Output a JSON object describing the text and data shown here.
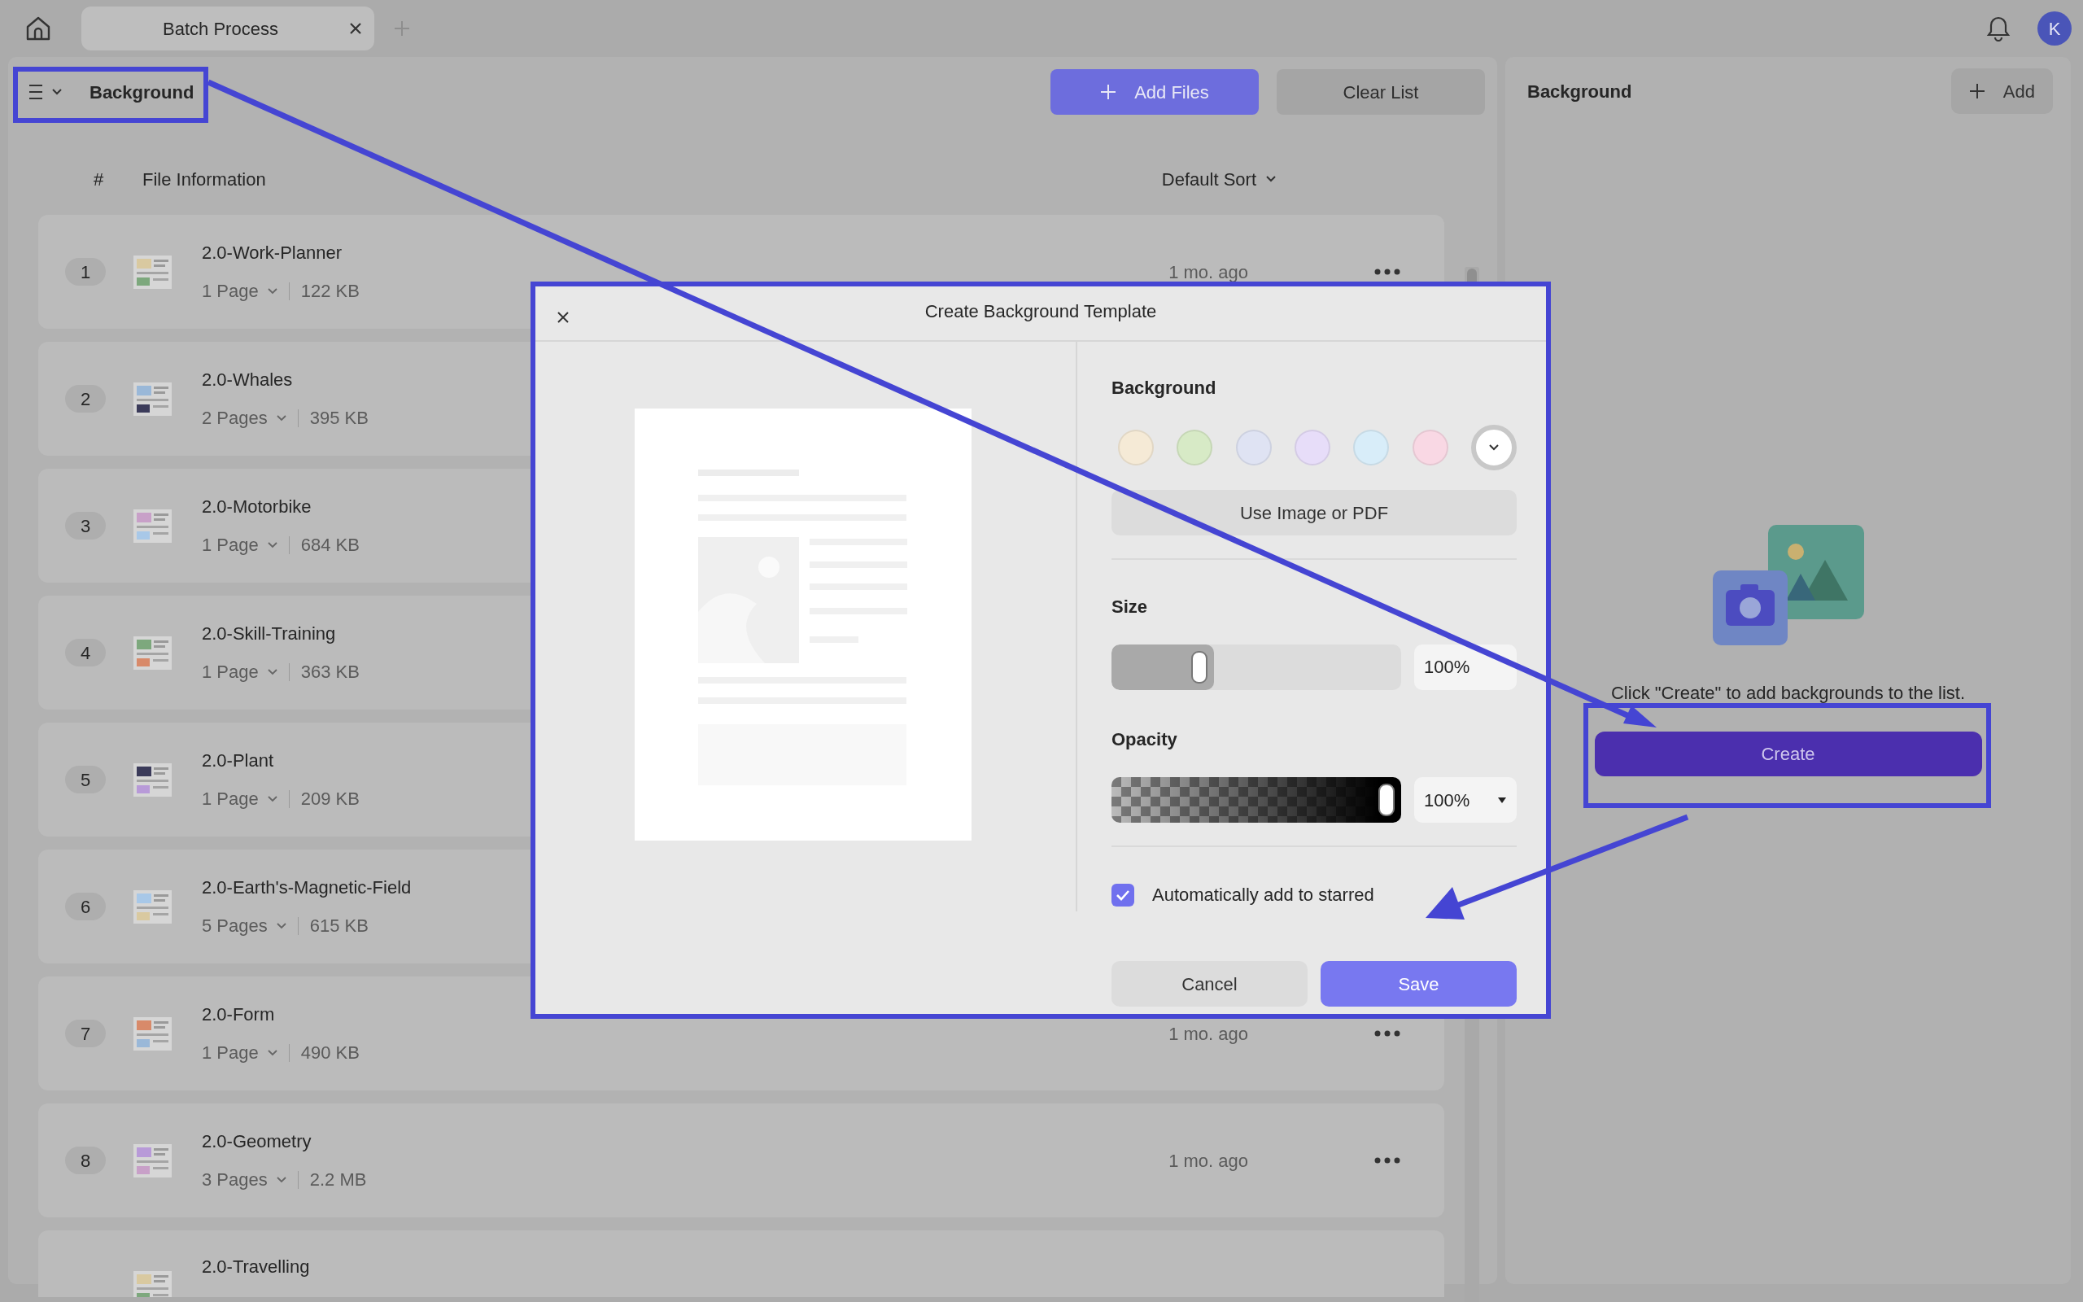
{
  "tabs": [
    {
      "label": "Batch Process",
      "selected": true
    }
  ],
  "user": {
    "initial": "K"
  },
  "toolbar": {
    "title": "Background",
    "buttons": [
      {
        "label": "Add Files",
        "kind": "primary"
      },
      {
        "label": "Clear List",
        "kind": "secondary"
      }
    ]
  },
  "file_list": {
    "columns": [
      "#",
      "File Information"
    ],
    "sort": "Default Sort",
    "rows": [
      {
        "index": "1",
        "name": "2.0-Work-Planner",
        "pages": "1 Page",
        "size": "122 KB",
        "time": "1 mo. ago"
      },
      {
        "index": "2",
        "name": "2.0-Whales",
        "pages": "2 Pages",
        "size": "395 KB"
      },
      {
        "index": "3",
        "name": "2.0-Motorbike",
        "pages": "1 Page",
        "size": "684 KB"
      },
      {
        "index": "4",
        "name": "2.0-Skill-Training",
        "pages": "1 Page",
        "size": "363 KB"
      },
      {
        "index": "5",
        "name": "2.0-Plant",
        "pages": "1 Page",
        "size": "209 KB"
      },
      {
        "index": "6",
        "name": "2.0-Earth's-Magnetic-Field",
        "pages": "5 Pages",
        "size": "615 KB"
      },
      {
        "index": "7",
        "name": "2.0-Form",
        "pages": "1 Page",
        "size": "490 KB",
        "time": "1 mo. ago"
      },
      {
        "index": "8",
        "name": "2.0-Geometry",
        "pages": "3 Pages",
        "size": "2.2 MB",
        "time": "1 mo. ago"
      },
      {
        "name": "2.0-Travelling"
      }
    ]
  },
  "dialog": {
    "title": "Create Background Template",
    "background": {
      "label": "Background",
      "swatches": [
        {
          "kind": "color",
          "color": "#f5ead6",
          "selected": false
        },
        {
          "kind": "color",
          "color": "#d7eac6",
          "selected": false
        },
        {
          "kind": "color",
          "color": "#dfe3f3",
          "selected": false
        },
        {
          "kind": "color",
          "color": "#e7ddf9",
          "selected": false
        },
        {
          "kind": "color",
          "color": "#d8edf9",
          "selected": false
        },
        {
          "kind": "color",
          "color": "#f9d8e4",
          "selected": false
        },
        {
          "kind": "more",
          "selected": true
        }
      ],
      "image_button": "Use Image or PDF"
    },
    "size": {
      "label": "Size",
      "level": 0.28,
      "reading": "100%"
    },
    "opacity": {
      "label": "Opacity",
      "level": 1,
      "reading": "100%"
    },
    "starred": {
      "label": "Automatically add to starred",
      "checked": true
    },
    "buttons": [
      {
        "label": "Cancel",
        "kind": "secondary"
      },
      {
        "label": "Save",
        "kind": "primary"
      }
    ]
  },
  "side_panel": {
    "title": "Background",
    "add_button": "Add",
    "hint": "Click \"Create\" to add backgrounds to the list.",
    "create_button": "Create"
  }
}
